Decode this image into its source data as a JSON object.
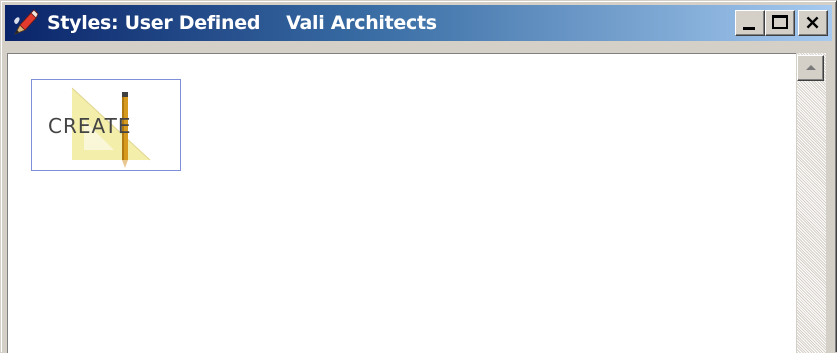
{
  "window": {
    "title": "Styles: User Defined",
    "subtitle": "Vali Architects",
    "app_icon": "pencil-brush-icon",
    "minimize_icon": "minimize-icon",
    "maximize_icon": "maximize-icon",
    "close_icon": "close-icon"
  },
  "styles": {
    "items": [
      {
        "thumbnail_text": "CREATE",
        "icon": "triangle-ruler-pencil-icon"
      }
    ]
  },
  "scrollbar": {
    "up_icon": "scroll-up-arrow-icon"
  },
  "colors": {
    "titlebar_start": "#0a246a",
    "titlebar_end": "#a6caf0",
    "selection_border": "#7f8fd8",
    "triangle_fill": "#f2eca0",
    "pencil_body": "#d69a1e"
  }
}
